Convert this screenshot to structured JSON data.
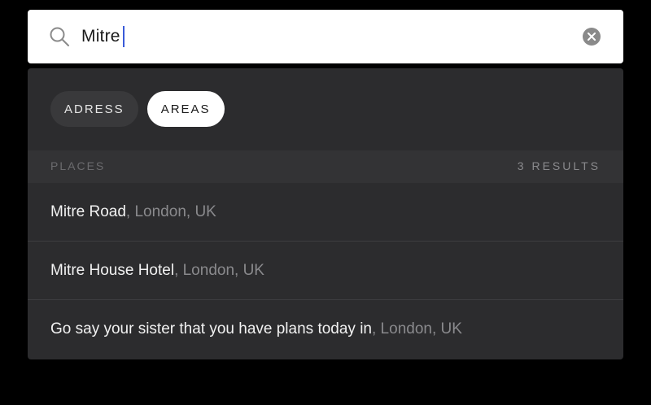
{
  "search": {
    "value": "Mitre",
    "icon": "search-icon",
    "clear_icon": "close-icon"
  },
  "tabs": [
    {
      "label": "ADRESS",
      "active": false
    },
    {
      "label": "AREAS",
      "active": true
    }
  ],
  "section": {
    "title": "PLACES",
    "count": "3 RESULTS"
  },
  "results": [
    {
      "name": "Mitre Road",
      "location": ", London, UK"
    },
    {
      "name": "Mitre House Hotel",
      "location": ", London, UK"
    },
    {
      "name": "Go say your sister that you have plans today in",
      "location": ", London, UK"
    }
  ],
  "colors": {
    "background": "#000000",
    "panel": "#2c2c2e",
    "caret": "#3a5bd9"
  }
}
